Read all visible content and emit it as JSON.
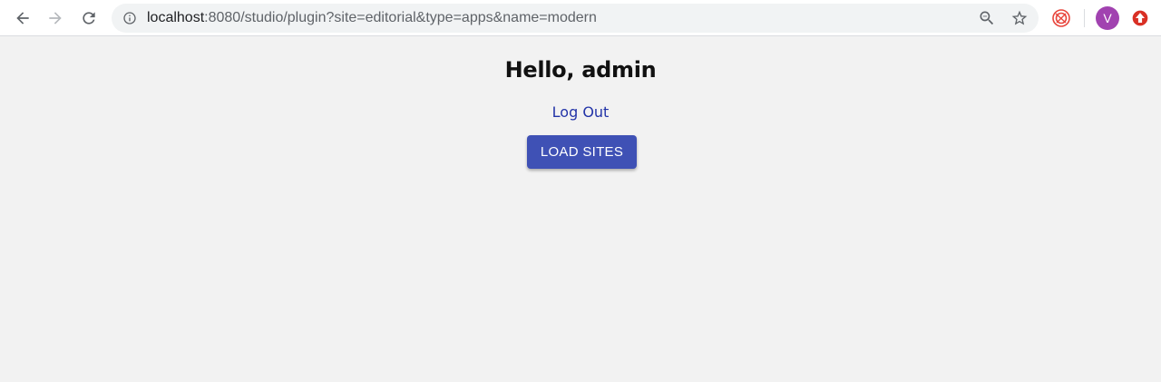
{
  "browser": {
    "url_host": "localhost",
    "url_rest": ":8080/studio/plugin?site=editorial&type=apps&name=modern",
    "profile_initial": "V",
    "colors": {
      "avatar": "#a142b0",
      "extension": "#e8453c",
      "alert": "#d93025"
    }
  },
  "page": {
    "greeting": "Hello, admin",
    "logout_label": "Log Out",
    "load_sites_label": "LOAD SITES",
    "colors": {
      "background": "#f2f2f2",
      "button": "#3f51b5",
      "link": "#2334a8"
    }
  },
  "icons": {
    "back": "arrow-left",
    "forward": "arrow-right",
    "reload": "reload",
    "site_info": "info-circle",
    "zoom": "magnifier-minus",
    "bookmark": "star-outline",
    "extension": "swirl-logo",
    "alert": "red-alert-circle"
  }
}
